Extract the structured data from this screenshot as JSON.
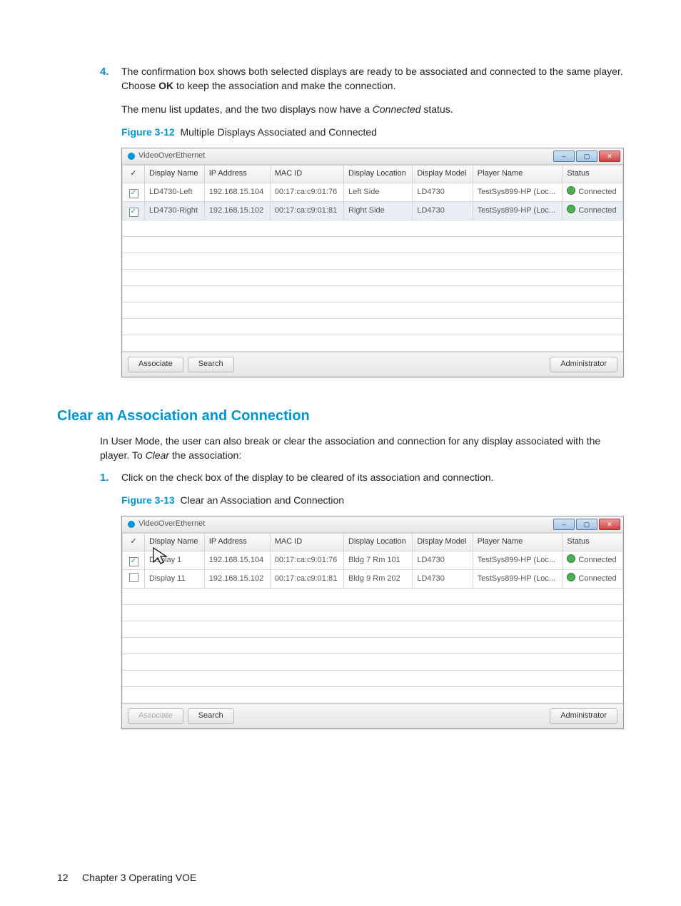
{
  "step4": {
    "number": "4.",
    "para1_a": "The confirmation box shows both selected displays are ready to be associated and connected to the same player. Choose ",
    "para1_ok": "OK",
    "para1_b": " to keep the association and make the connection.",
    "para2_a": "The menu list updates, and the two displays now have a ",
    "para2_status": "Connected",
    "para2_b": " status."
  },
  "figure12": {
    "label": "Figure 3-12",
    "title": "Multiple Displays Associated and Connected"
  },
  "screenshot1": {
    "title": "VideoOverEthernet",
    "columns": {
      "check": "✓",
      "display_name": "Display Name",
      "ip": "IP Address",
      "mac": "MAC ID",
      "location": "Display Location",
      "model": "Display Model",
      "player": "Player Name",
      "status": "Status"
    },
    "rows": [
      {
        "checked": true,
        "name": "LD4730-Left",
        "ip": "192.168.15.104",
        "mac": "00:17:ca:c9:01:76",
        "location": "Left Side",
        "model": "LD4730",
        "player": "TestSys899-HP (Loc...",
        "status": "Connected",
        "selected": false
      },
      {
        "checked": true,
        "name": "LD4730-Right",
        "ip": "192.168.15.102",
        "mac": "00:17:ca:c9:01:81",
        "location": "Right Side",
        "model": "LD4730",
        "player": "TestSys899-HP (Loc...",
        "status": "Connected",
        "selected": true
      }
    ],
    "buttons": {
      "associate": "Associate",
      "search": "Search",
      "admin": "Administrator"
    }
  },
  "section": {
    "heading": "Clear an Association and Connection",
    "intro_a": "In User Mode, the user can also break or clear the association and connection for any display associated with the player. To ",
    "intro_clear": "Clear",
    "intro_b": " the association:"
  },
  "step1": {
    "number": "1.",
    "text": "Click on the check box of the display to be cleared of its association and connection."
  },
  "figure13": {
    "label": "Figure 3-13",
    "title": "Clear an Association and Connection"
  },
  "screenshot2": {
    "title": "VideoOverEthernet",
    "columns": {
      "check": "✓",
      "display_name": "Display Name",
      "ip": "IP Address",
      "mac": "MAC ID",
      "location": "Display Location",
      "model": "Display Model",
      "player": "Player Name",
      "status": "Status"
    },
    "rows": [
      {
        "checked": true,
        "name": "Display 1",
        "ip": "192.168.15.104",
        "mac": "00:17:ca:c9:01:76",
        "location": "Bldg 7  Rm 101",
        "model": "LD4730",
        "player": "TestSys899-HP (Loc...",
        "status": "Connected"
      },
      {
        "checked": false,
        "name": "Display 11",
        "ip": "192.168.15.102",
        "mac": "00:17:ca:c9:01:81",
        "location": "Bldg 9  Rm 202",
        "model": "LD4730",
        "player": "TestSys899-HP (Loc...",
        "status": "Connected"
      }
    ],
    "buttons": {
      "associate": "Associate",
      "search": "Search",
      "admin": "Administrator"
    }
  },
  "footer": {
    "page_number": "12",
    "chapter": "Chapter 3   Operating VOE"
  }
}
